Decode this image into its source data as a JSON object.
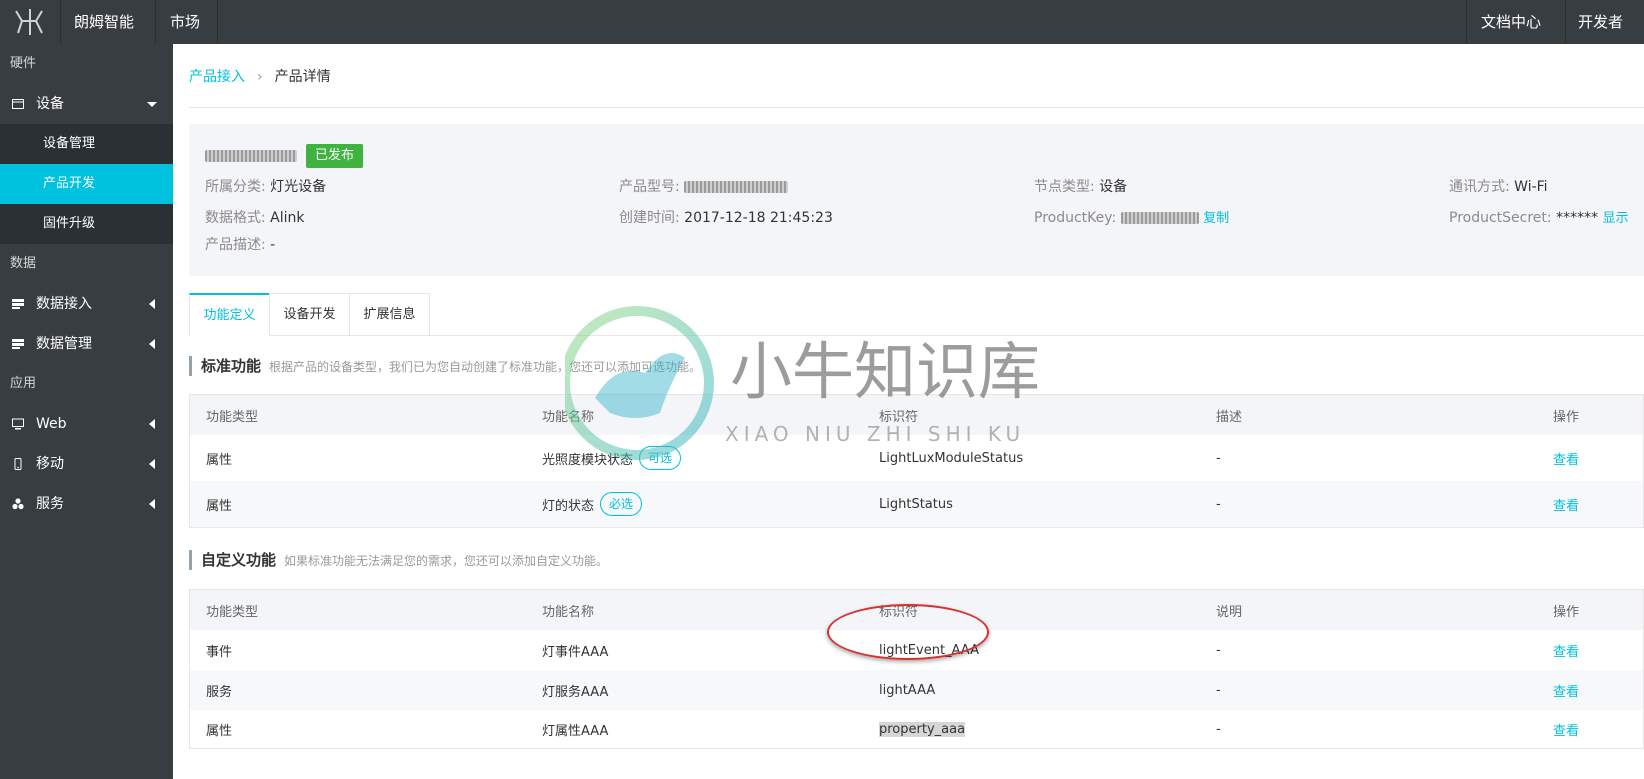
{
  "topbar": {
    "org_label": "朗姆智能",
    "market_label": "市场",
    "docs_label": "文档中心",
    "community_label": "开发者社区"
  },
  "sidebar": {
    "sections": [
      "硬件",
      "数据",
      "应用"
    ],
    "device_label": "设备",
    "sub_items": [
      "设备管理",
      "产品开发",
      "固件升级"
    ],
    "data_items": [
      "数据接入",
      "数据管理"
    ],
    "app_items": [
      "Web",
      "移动",
      "服务"
    ]
  },
  "breadcrumb": {
    "parent": "产品接入",
    "current": "产品详情"
  },
  "product": {
    "status": "已发布",
    "category_key": "所属分类:",
    "category_val": "灯光设备",
    "model_key": "产品型号:",
    "node_key": "节点类型:",
    "node_val": "设备",
    "comm_key": "通讯方式:",
    "comm_val": "Wi-Fi",
    "format_key": "数据格式:",
    "format_val": "Alink",
    "created_key": "创建时间:",
    "created_val": "2017-12-18 21:45:23",
    "pk_key": "ProductKey:",
    "pk_copy": "复制",
    "ps_key": "ProductSecret:",
    "ps_val": "******",
    "ps_show": "显示",
    "desc_key": "产品描述:",
    "desc_val": "-"
  },
  "tabs": [
    "功能定义",
    "设备开发",
    "扩展信息"
  ],
  "standard": {
    "title": "标准功能",
    "hint": "根据产品的设备类型，我们已为您自动创建了标准功能，您还可以添加可选功能。",
    "headers": [
      "功能类型",
      "功能名称",
      "标识符",
      "描述",
      "操作"
    ],
    "rows": [
      {
        "type": "属性",
        "name": "光照度模块状态",
        "tag": "可选",
        "id": "LightLuxModuleStatus",
        "desc": "-",
        "action": "查看"
      },
      {
        "type": "属性",
        "name": "灯的状态",
        "tag": "必选",
        "id": "LightStatus",
        "desc": "-",
        "action": "查看"
      }
    ]
  },
  "custom": {
    "title": "自定义功能",
    "hint": "如果标准功能无法满足您的需求，您还可以添加自定义功能。",
    "headers": [
      "功能类型",
      "功能名称",
      "标识符",
      "说明",
      "操作"
    ],
    "rows": [
      {
        "type": "事件",
        "name": "灯事件AAA",
        "id": "lightEvent_AAA",
        "desc": "-",
        "action": "查看"
      },
      {
        "type": "服务",
        "name": "灯服务AAA",
        "id": "lightAAA",
        "desc": "-",
        "action": "查看"
      },
      {
        "type": "属性",
        "name": "灯属性AAA",
        "id": "property_aaa",
        "desc": "-",
        "action": "查看"
      }
    ]
  },
  "watermark": {
    "title": "小牛知识库",
    "subtitle": "XIAO NIU ZHI SHI KU"
  }
}
